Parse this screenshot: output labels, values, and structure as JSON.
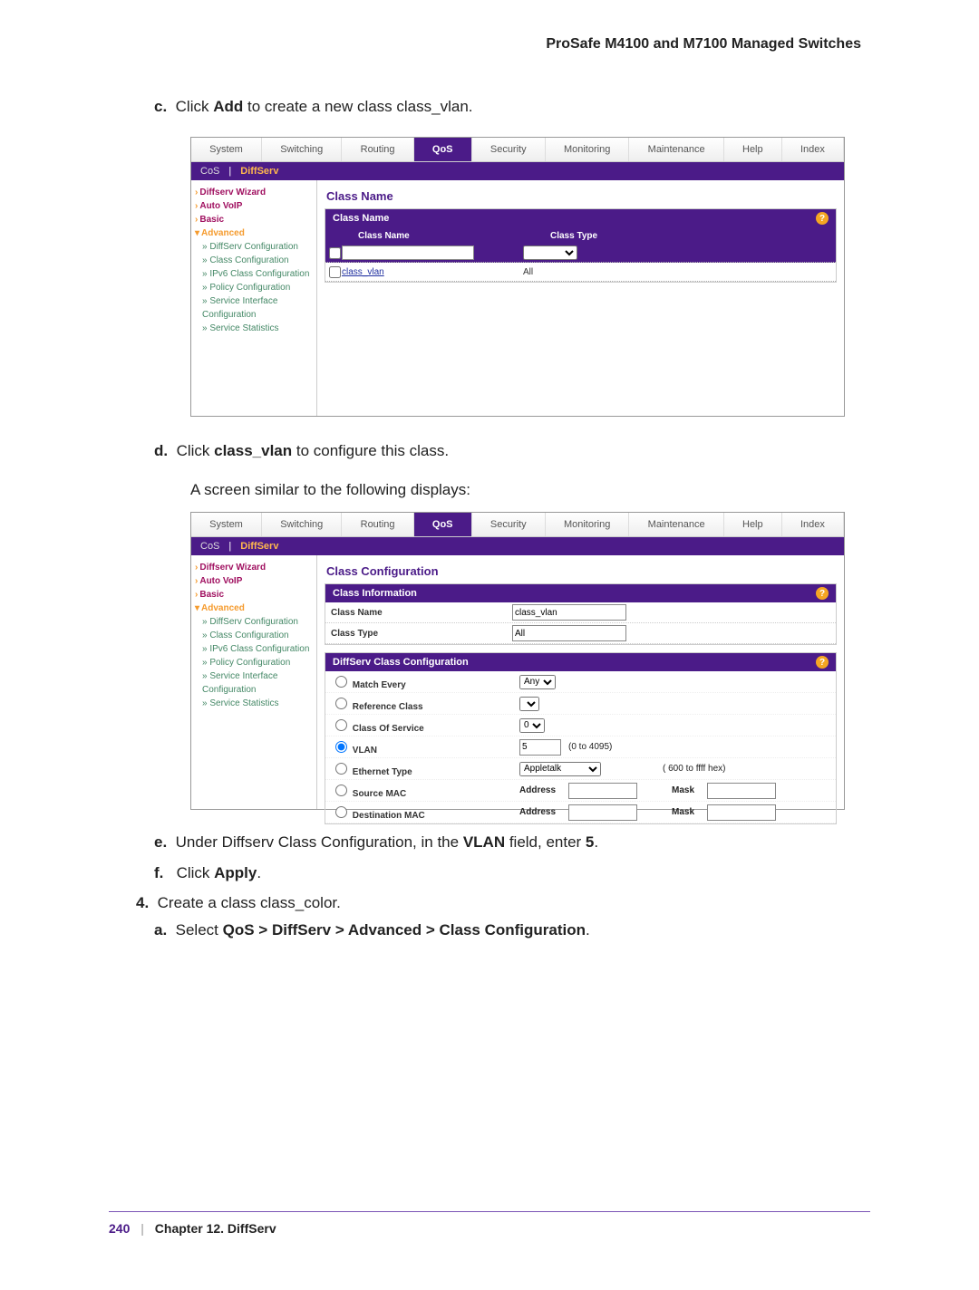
{
  "docHeader": "ProSafe M4100 and M7100 Managed Switches",
  "step_c": {
    "prefix": "c.",
    "pre": "Click ",
    "bold": "Add",
    "post": " to create a new class class_vlan."
  },
  "step_d": {
    "prefix": "d.",
    "pre": "Click ",
    "bold": "class_vlan",
    "post": " to configure this class."
  },
  "after_d": "A screen similar to the following displays:",
  "step_e": {
    "prefix": "e.",
    "pre": "Under Diffserv Class Configuration, in the ",
    "bold": "VLAN",
    "post": " field, enter ",
    "bold2": "5",
    "tail": "."
  },
  "step_f": {
    "prefix": "f.",
    "pre": "Click ",
    "bold": "Apply",
    "post": "."
  },
  "step_4": {
    "prefix": "4.",
    "text": "Create a class class_color."
  },
  "step_a": {
    "prefix": "a.",
    "pre": "Select ",
    "bold": "QoS > DiffServ > Advanced > Class Configuration",
    "post": "."
  },
  "tabs": [
    "System",
    "Switching",
    "Routing",
    "QoS",
    "Security",
    "Monitoring",
    "Maintenance",
    "Help",
    "Index"
  ],
  "activeTab": "QoS",
  "subTabs": {
    "left": "CoS",
    "right": "DiffServ"
  },
  "sidenav": {
    "wizard": "Diffserv Wizard",
    "autovoip": "Auto VoIP",
    "basic": "Basic",
    "advanced": "Advanced",
    "items": [
      "DiffServ Configuration",
      "Class Configuration",
      "IPv6 Class Configuration",
      "Policy Configuration",
      "Service Interface Configuration",
      "Service Statistics"
    ]
  },
  "shot1": {
    "title": "Class Name",
    "panelTitle": "Class Name",
    "colClass": "Class Name",
    "colType": "Class Type",
    "row2Name": "class_vlan",
    "row2Type": "All"
  },
  "shot2": {
    "title": "Class Configuration",
    "panel1": "Class Information",
    "classNameLbl": "Class Name",
    "classNameVal": "class_vlan",
    "classTypeLbl": "Class Type",
    "classTypeVal": "All",
    "panel2": "DiffServ Class Configuration",
    "matchEvery": "Match Every",
    "matchEveryVal": "Any",
    "refClass": "Reference Class",
    "cos": "Class Of Service",
    "cosVal": "0",
    "vlan": "VLAN",
    "vlanVal": "5",
    "vlanRange": "(0 to 4095)",
    "ethType": "Ethernet Type",
    "ethVal": "Appletalk",
    "ethRange": "( 600 to ffff hex)",
    "srcMac": "Source MAC",
    "dstMac": "Destination MAC",
    "address": "Address",
    "mask": "Mask"
  },
  "footer": {
    "page": "240",
    "chapter": "Chapter 12.  DiffServ"
  }
}
